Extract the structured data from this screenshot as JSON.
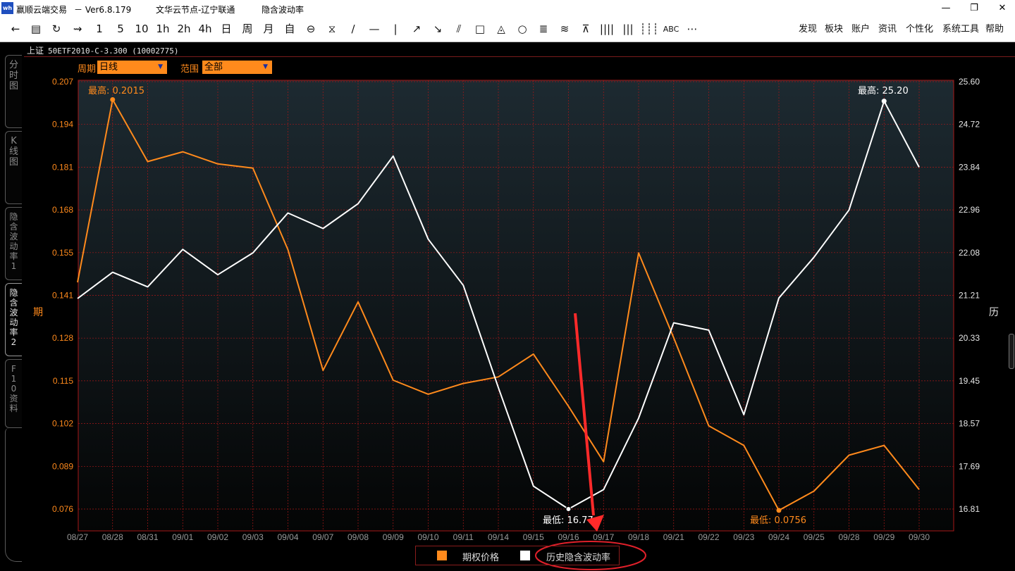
{
  "window": {
    "title": "赢顺云端交易",
    "version": "－ Ver6.8.179",
    "server": "文华云节点-辽宁联通",
    "view": "隐含波动率",
    "logo_text": "wh"
  },
  "window_controls": {
    "minimize": "—",
    "maximize": "❐",
    "close": "✕"
  },
  "toolbar": {
    "tools": [
      "←",
      "▤",
      "↻",
      "⇝",
      "1",
      "5",
      "10",
      "1h",
      "2h",
      "4h",
      "日",
      "周",
      "月",
      "自",
      "⊖",
      "⧖",
      "∕",
      "—",
      "|",
      "↗",
      "↘",
      "⫽",
      "□",
      "◬",
      "○",
      "≣",
      "≋",
      "⊼",
      "||||",
      "|||",
      "┊┊┊",
      "ABC",
      "⋯"
    ],
    "menus": [
      "发现",
      "板块",
      "账户",
      "资讯",
      "个性化",
      "系统工具",
      "帮助"
    ]
  },
  "sidebar_tabs": [
    {
      "label": "分时图",
      "active": false
    },
    {
      "label": "K线图",
      "active": false
    },
    {
      "label": "隐含波动率1",
      "active": false
    },
    {
      "label": "隐含波动率2",
      "active": true
    },
    {
      "label": "F10资料",
      "active": false
    }
  ],
  "instrument": {
    "exchange": "上证",
    "code": "50ETF2010-C-3.300 (10002775)"
  },
  "controls": {
    "period_label": "周期",
    "period_value": "日线",
    "range_label": "范围",
    "range_value": "全部"
  },
  "chart_data": {
    "type": "line",
    "categories": [
      "08/27",
      "08/28",
      "08/31",
      "09/01",
      "09/02",
      "09/03",
      "09/04",
      "09/07",
      "09/08",
      "09/09",
      "09/10",
      "09/11",
      "09/14",
      "09/15",
      "09/16",
      "09/17",
      "09/18",
      "09/21",
      "09/22",
      "09/23",
      "09/24",
      "09/25",
      "09/28",
      "09/29",
      "09/30"
    ],
    "series": [
      {
        "name": "期权价格",
        "axis": "left",
        "color": "#ff8a1c",
        "values": [
          0.1455,
          0.2015,
          0.1825,
          0.1855,
          0.1818,
          0.1805,
          0.1555,
          0.1185,
          0.1395,
          0.1155,
          0.1112,
          0.1145,
          0.1165,
          0.1235,
          0.1075,
          0.0905,
          0.1545,
          0.1285,
          0.1015,
          0.0955,
          0.0756,
          0.0815,
          0.0925,
          0.0955,
          0.082
        ]
      },
      {
        "name": "历史隐含波动率",
        "axis": "right",
        "color": "#ffffff",
        "values": [
          21.14,
          21.68,
          21.38,
          22.15,
          21.63,
          22.08,
          22.9,
          22.58,
          23.09,
          24.07,
          22.36,
          21.41,
          19.31,
          17.28,
          16.81,
          17.21,
          18.68,
          20.64,
          20.49,
          18.75,
          21.15,
          21.99,
          22.96,
          25.2,
          23.84
        ]
      }
    ],
    "left_axis": {
      "label": "期",
      "ticks": [
        "0.207",
        "0.194",
        "0.181",
        "0.168",
        "0.155",
        "0.141",
        "0.128",
        "0.115",
        "0.102",
        "0.089",
        "0.076"
      ],
      "range": [
        0.076,
        0.207
      ]
    },
    "right_axis": {
      "label": "历",
      "ticks": [
        "25.60",
        "24.72",
        "23.84",
        "22.96",
        "22.08",
        "21.21",
        "20.33",
        "19.45",
        "18.57",
        "17.69",
        "16.81"
      ],
      "range": [
        16.81,
        25.6
      ]
    },
    "annotations": {
      "option_high": "最高: 0.2015",
      "option_low": "最低: 0.0756",
      "iv_high": "最高: 25.20",
      "iv_low": "最低: 16.77"
    },
    "grid": true,
    "legend": "bottom-center"
  },
  "colors": {
    "option_line": "#ff8a1c",
    "iv_line": "#ffffff",
    "grid": "#a81818",
    "highlight_red": "#ff2a2a"
  }
}
